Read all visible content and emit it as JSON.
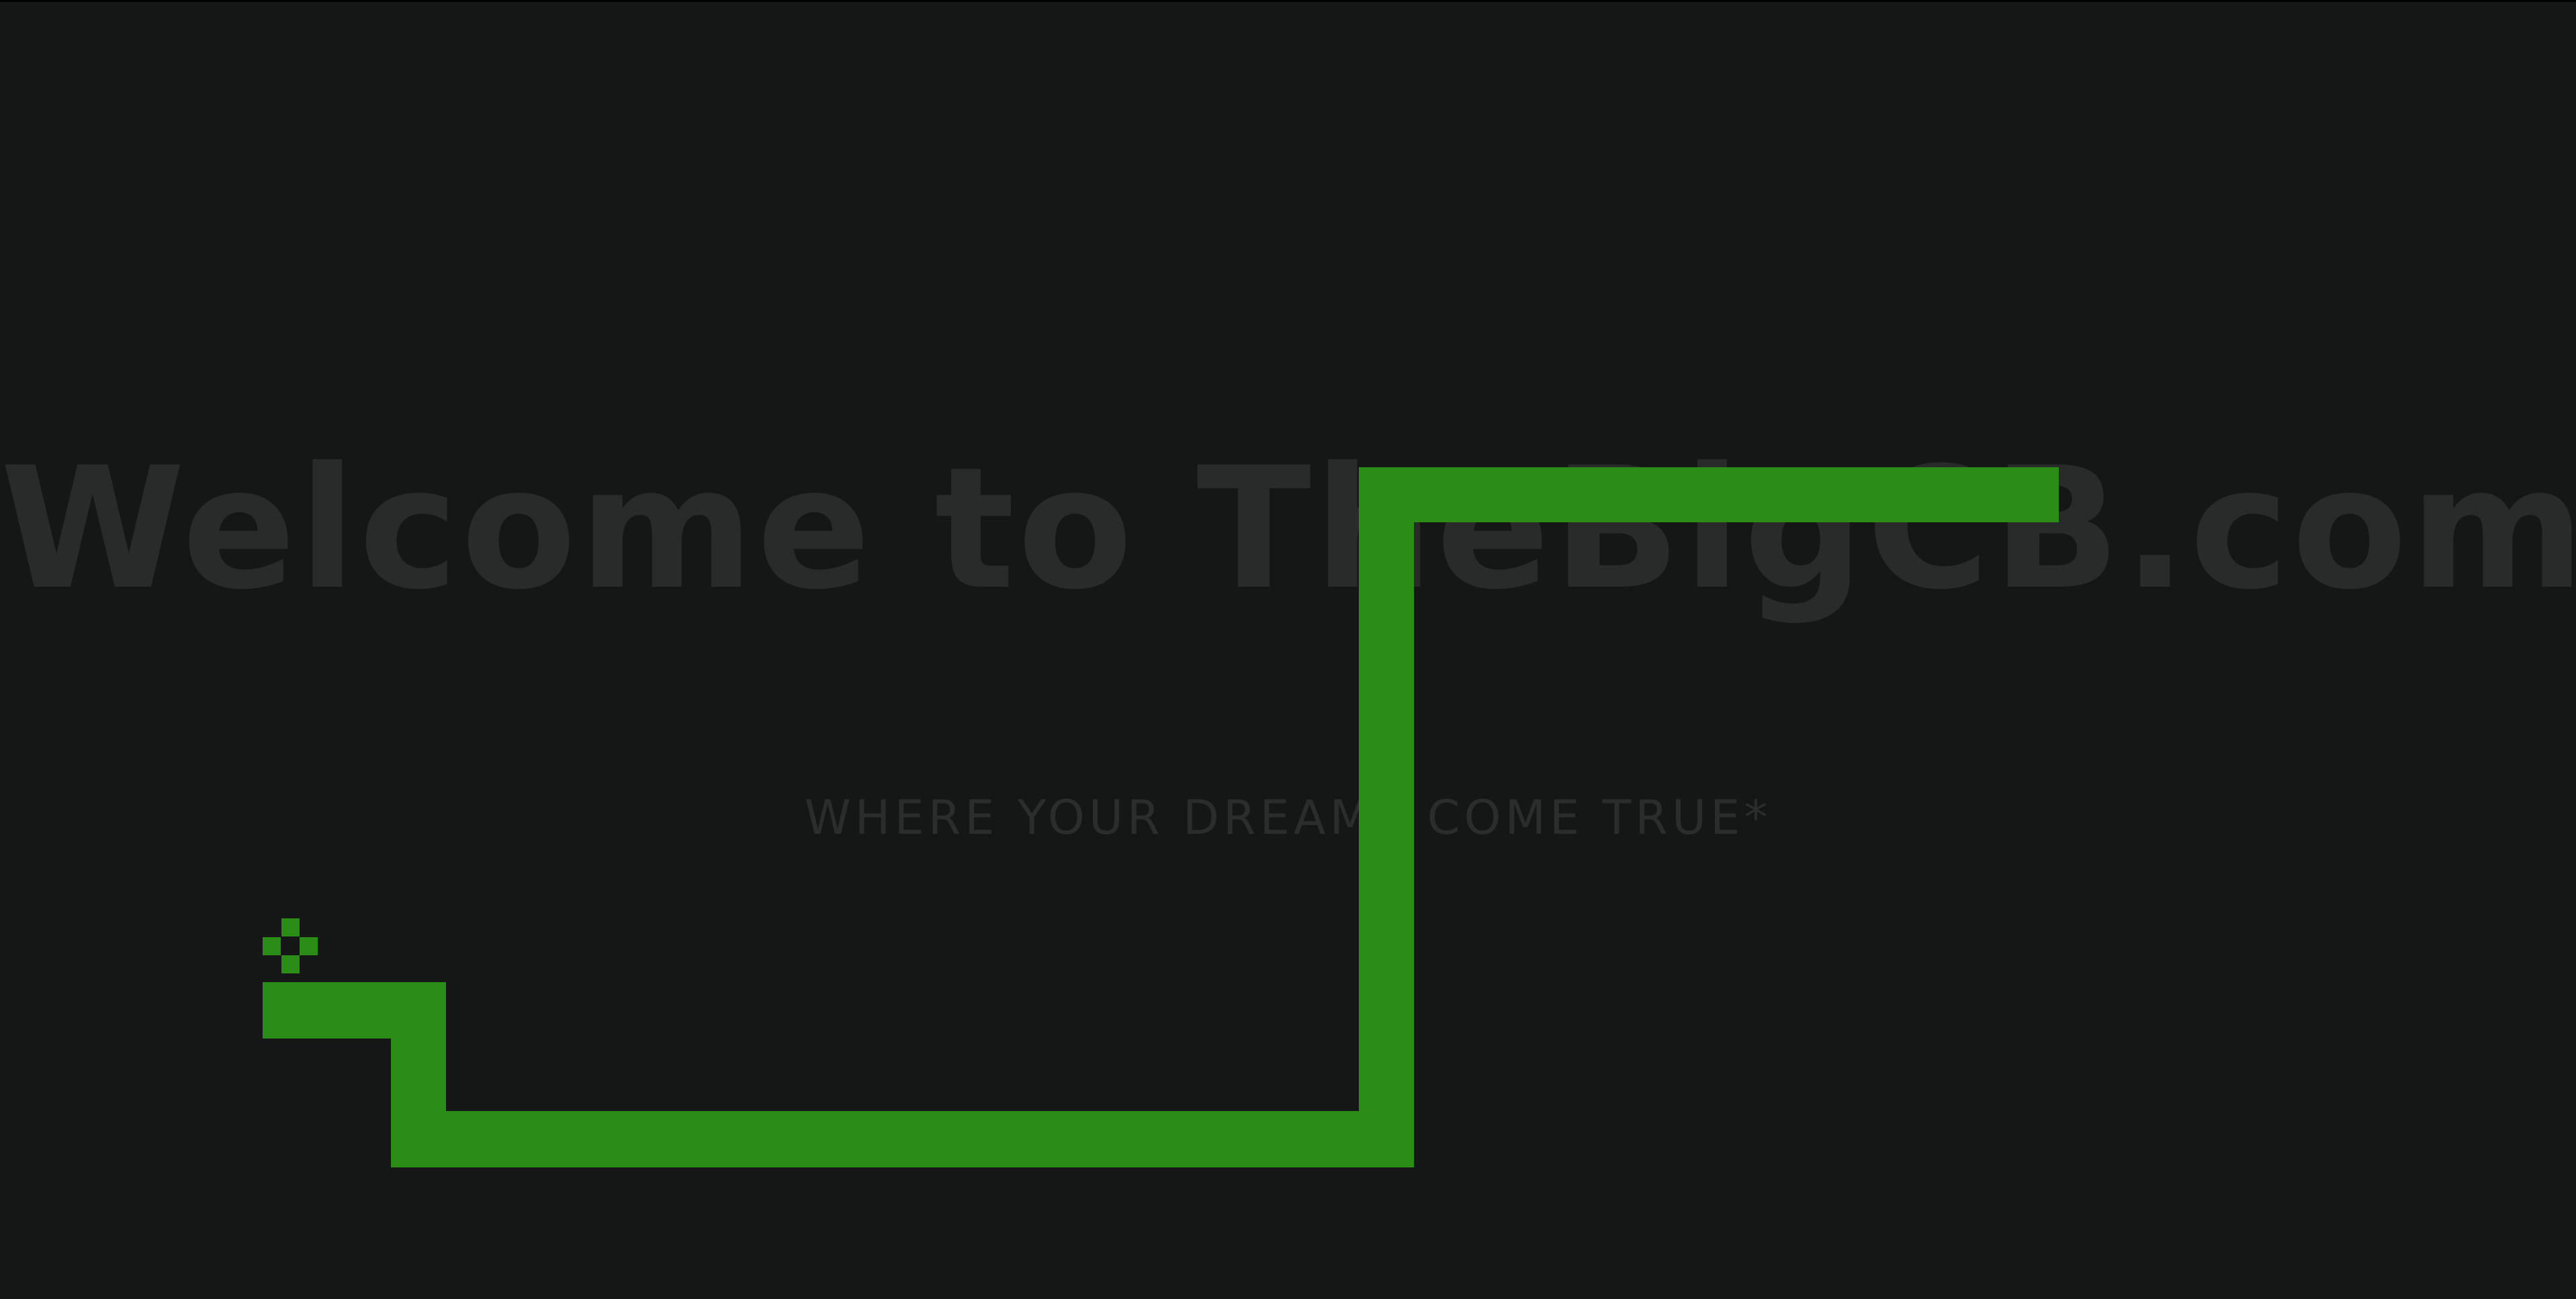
{
  "hero": {
    "title": "Welcome to TheBigCB.com",
    "subtitle": "WHERE YOUR DREAMS COME TRUE*"
  },
  "game": {
    "snake_color": "#2b8c16",
    "background_color": "#151616",
    "text_color": "#292a2a",
    "food_icon": "plus-pixel-icon"
  }
}
